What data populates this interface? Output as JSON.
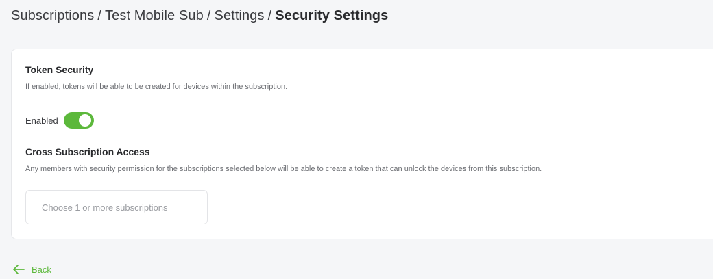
{
  "breadcrumb": {
    "items": [
      "Subscriptions",
      "Test Mobile Sub",
      "Settings"
    ],
    "current": "Security Settings",
    "separator": "/"
  },
  "token_security": {
    "title": "Token Security",
    "description": "If enabled, tokens will be able to be created for devices within the subscription.",
    "toggle_label": "Enabled",
    "enabled": true
  },
  "cross_subscription": {
    "title": "Cross Subscription Access",
    "description": "Any members with security permission for the subscriptions selected below will be able to create a token that can unlock the devices from this subscription.",
    "select_placeholder": "Choose 1 or more subscriptions"
  },
  "footer": {
    "back_label": "Back",
    "back_icon": "arrow-left-icon"
  },
  "colors": {
    "accent": "#5cb83b",
    "background": "#f5f6f8",
    "card": "#ffffff"
  }
}
